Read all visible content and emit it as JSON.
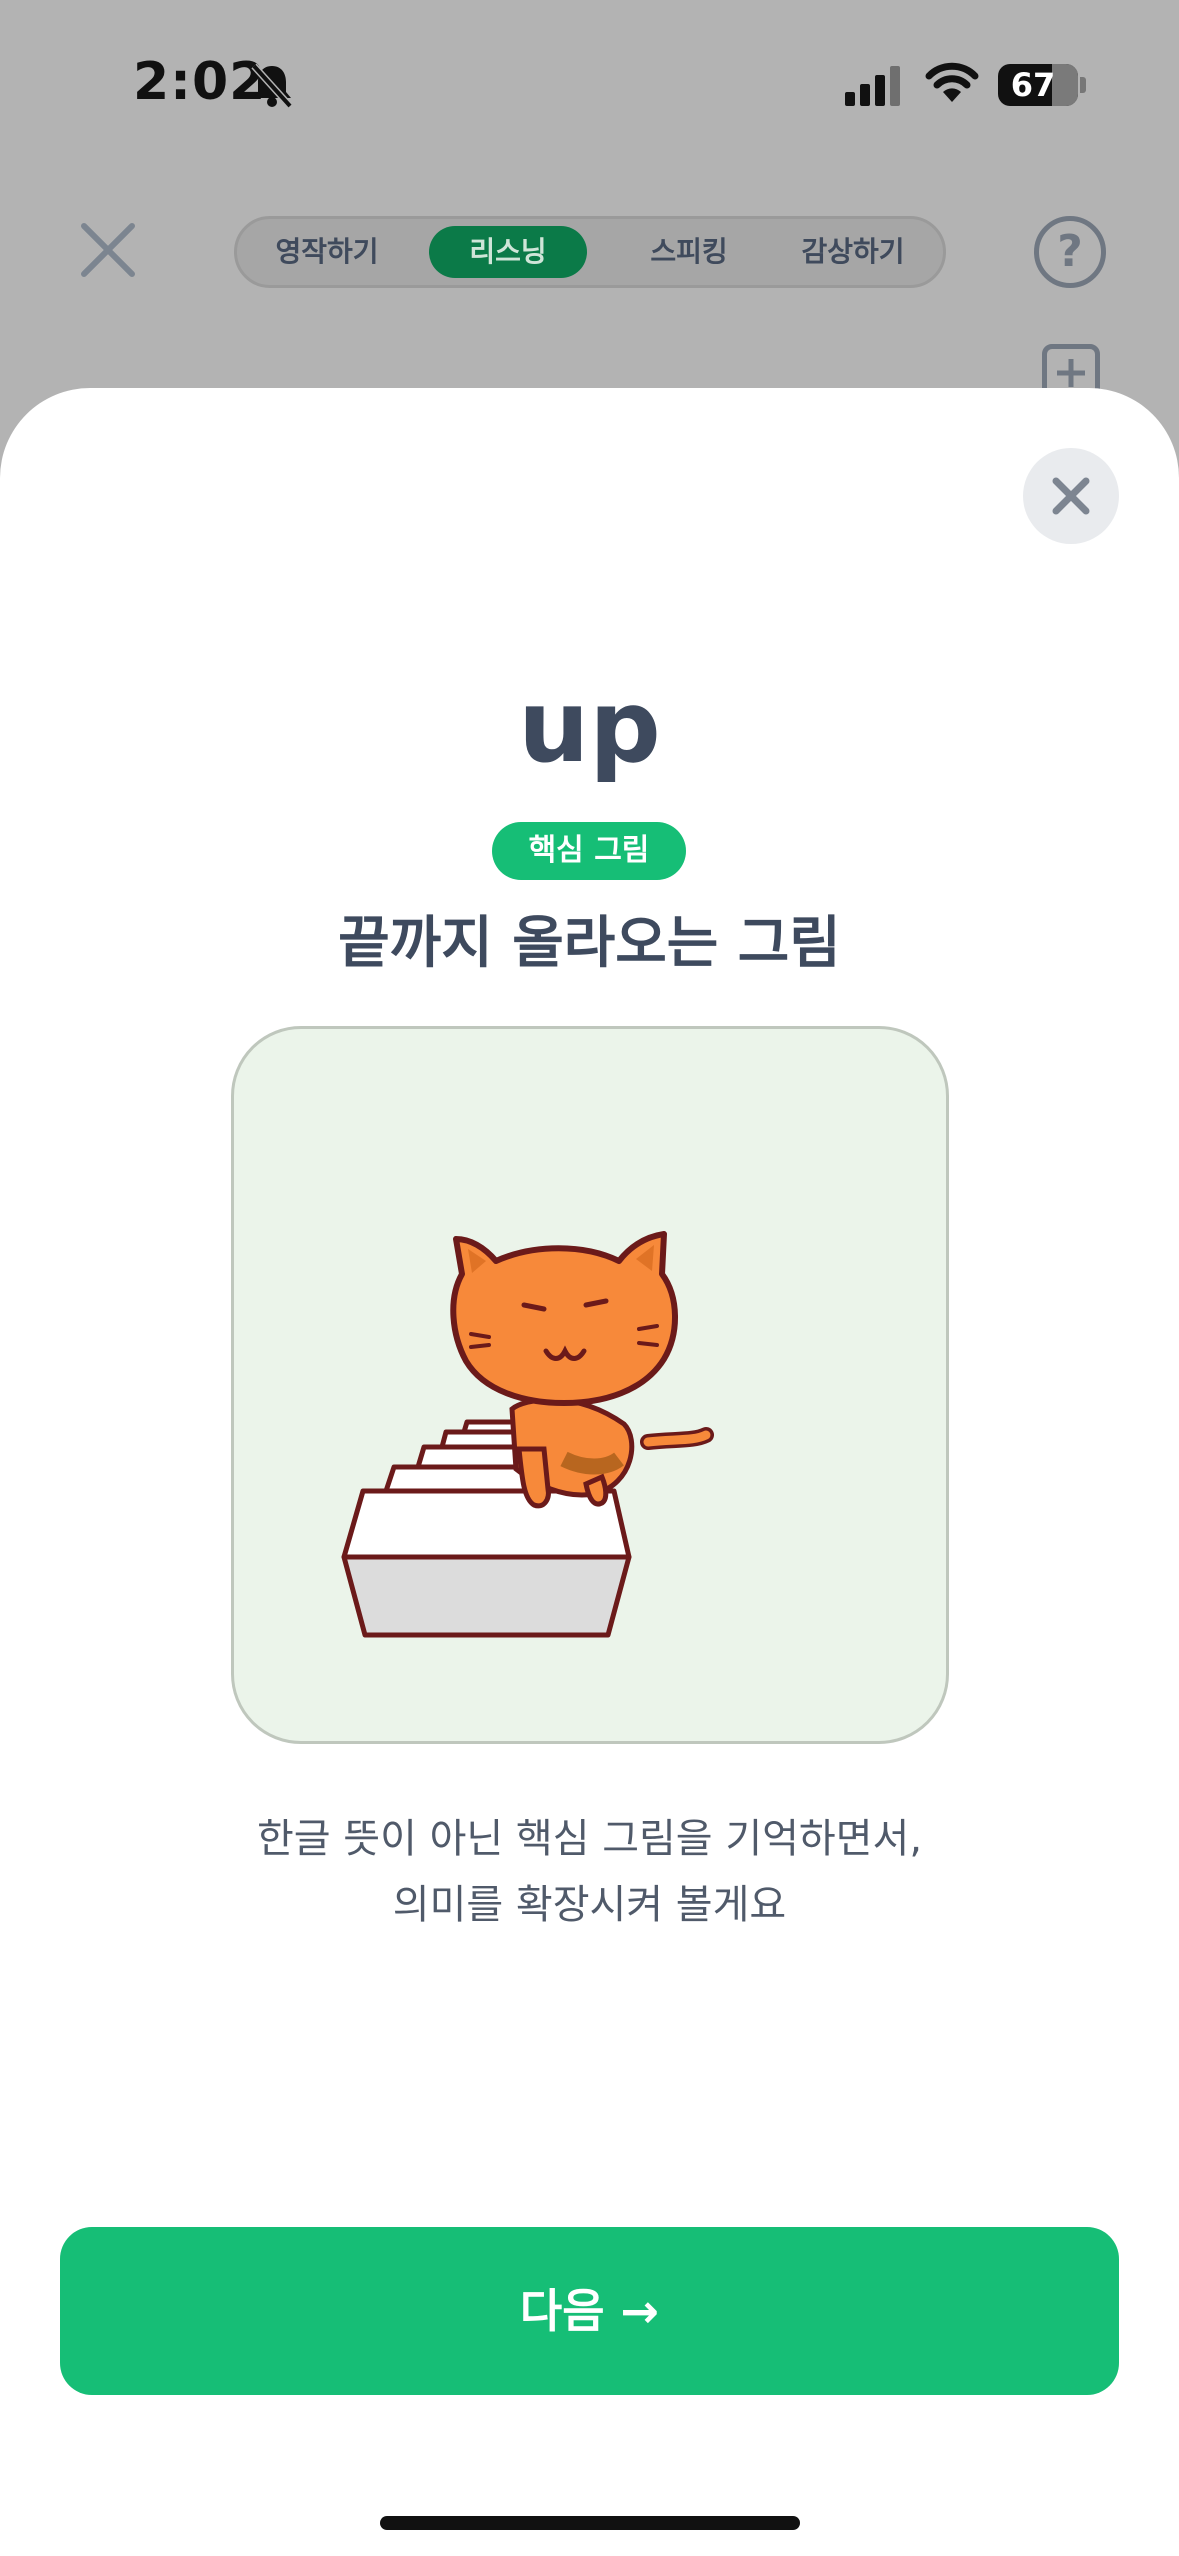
{
  "status_bar": {
    "time": "2:02",
    "battery_level": "67"
  },
  "header": {
    "tabs": [
      {
        "label": "영작하기",
        "active": false
      },
      {
        "label": "리스닝",
        "active": true
      },
      {
        "label": "스피킹",
        "active": false
      },
      {
        "label": "감상하기",
        "active": false
      }
    ],
    "help_label": "?"
  },
  "sheet": {
    "word": "up",
    "badge": "핵심 그림",
    "subtitle": "끝까지 올라오는 그림",
    "description_line1": "한글 뜻이 아닌 핵심 그림을 기억하면서,",
    "description_line2": "의미를 확장시켜 볼게요",
    "next_button": "다음 →"
  },
  "colors": {
    "accent": "#16be76",
    "active_tab": "#0b7a48",
    "text_dark": "#3e4a5e",
    "card_bg": "#ebf4ea",
    "cat": "#f7893a"
  }
}
